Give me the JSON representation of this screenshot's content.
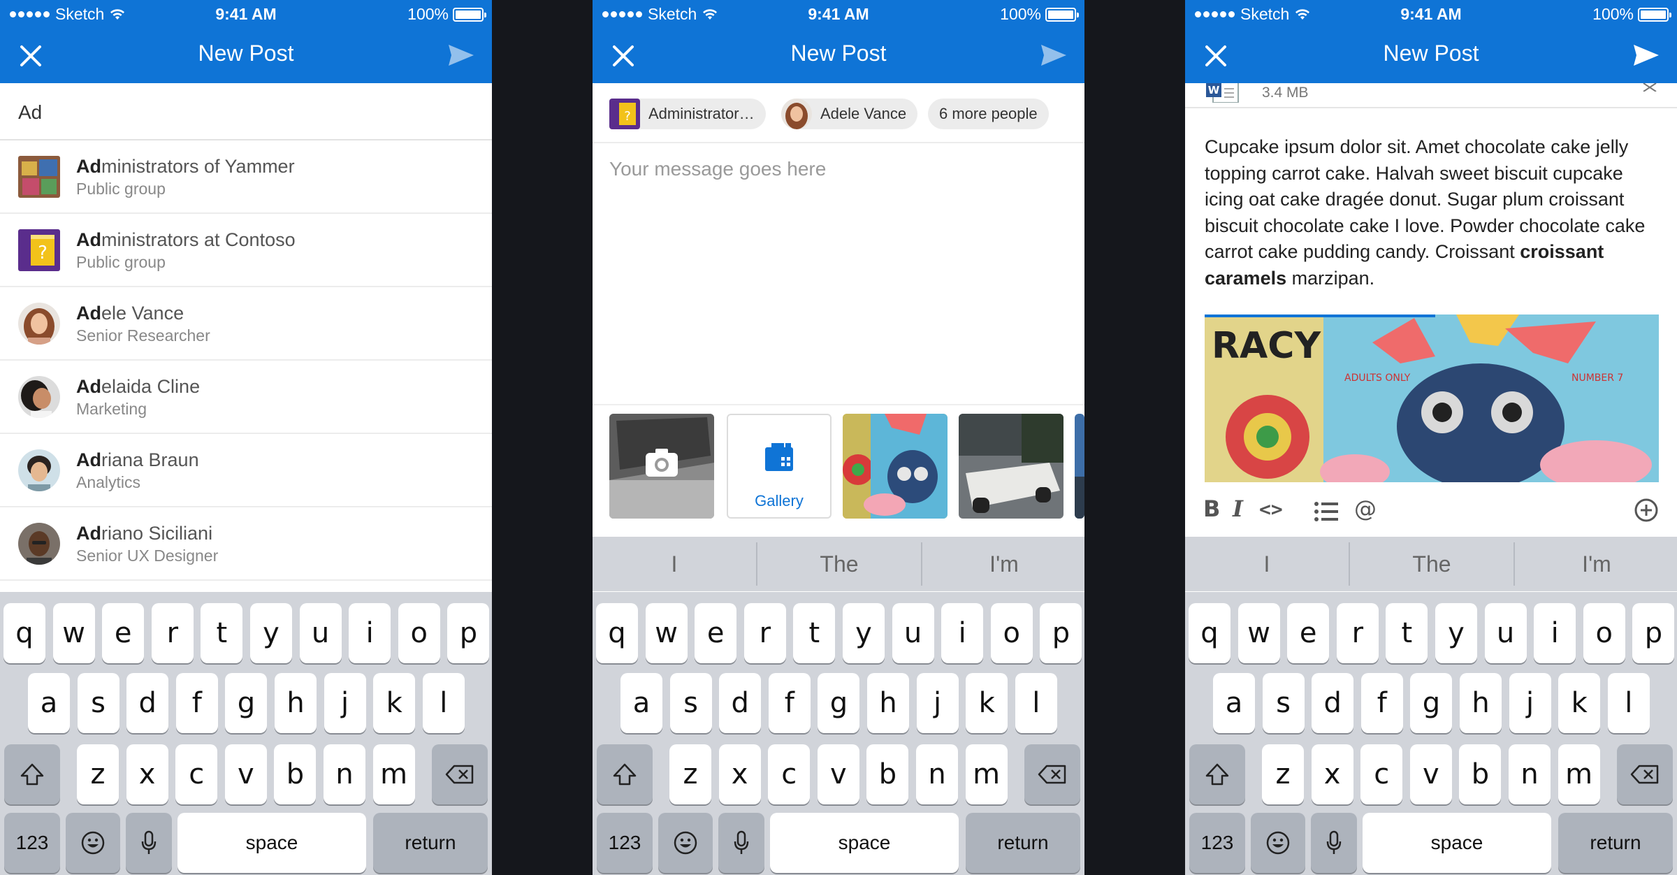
{
  "status": {
    "carrier": "Sketch",
    "time": "9:41 AM",
    "battery": "100%"
  },
  "nav": {
    "title": "New Post"
  },
  "screen1": {
    "search_value": "Ad",
    "suggestions": [
      {
        "match": "Ad",
        "rest": "ministrators of Yammer",
        "sub": "Public group"
      },
      {
        "match": "Ad",
        "rest": "ministrators at Contoso",
        "sub": "Public group"
      },
      {
        "match": "Ad",
        "rest": "ele Vance",
        "sub": "Senior Researcher"
      },
      {
        "match": "Ad",
        "rest": "elaida Cline",
        "sub": "Marketing"
      },
      {
        "match": "Ad",
        "rest": "riana Braun",
        "sub": "Analytics"
      },
      {
        "match": "Ad",
        "rest": "riano Siciliani",
        "sub": "Senior UX Designer"
      }
    ]
  },
  "screen2": {
    "chips": [
      "Administrator…",
      "Adele Vance",
      "6 more people"
    ],
    "message_placeholder": "Your message goes here",
    "gallery_label": "Gallery"
  },
  "screen3": {
    "attachment_size": "3.4 MB",
    "body_before": "Cupcake ipsum dolor sit. Amet chocolate cake jelly topping carrot cake. Halvah sweet biscuit cupcake icing oat cake dragée donut. Sugar plum croissant biscuit chocolate cake I love. Powder chocolate cake carrot cake pudding candy. Croissant ",
    "body_bold": "croissant caramels",
    "body_after": " marzipan.",
    "format_buttons": [
      "B",
      "I",
      "<>",
      "list",
      "@",
      "+"
    ]
  },
  "keyboard": {
    "suggestions": [
      "I",
      "The",
      "I'm"
    ],
    "row1": [
      "q",
      "w",
      "e",
      "r",
      "t",
      "y",
      "u",
      "i",
      "o",
      "p"
    ],
    "row2": [
      "a",
      "s",
      "d",
      "f",
      "g",
      "h",
      "j",
      "k",
      "l"
    ],
    "row3": [
      "z",
      "x",
      "c",
      "v",
      "b",
      "n",
      "m"
    ],
    "numbers_label": "123",
    "space_label": "space",
    "return_label": "return"
  },
  "colors": {
    "accent": "#0f74d6",
    "keyboard_bg": "#d1d4da",
    "background": "#15171c"
  }
}
